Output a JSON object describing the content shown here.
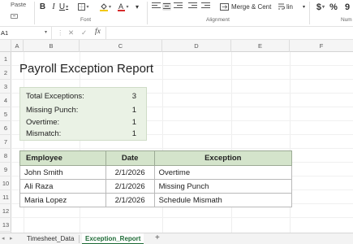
{
  "ribbon": {
    "paste_label": "Paste",
    "font_group_label": "Font",
    "alignment_group_label": "Alignment",
    "number_group_label": "Num",
    "merge_label": "Merge & Cent",
    "wrap_label": "lin",
    "currency_symbol": "$",
    "percent_symbol": "%"
  },
  "formula_bar": {
    "name_box": "A1",
    "cancel_glyph": "✕",
    "confirm_glyph": "✓",
    "fx_label": "fx",
    "formula": ""
  },
  "columns": [
    "A",
    "B",
    "C",
    "D",
    "E",
    "F"
  ],
  "rows": [
    "1",
    "2",
    "3",
    "4",
    "5",
    "6",
    "7",
    "8",
    "9",
    "10",
    "11",
    "12",
    "13"
  ],
  "report": {
    "title": "Payroll Exception Report",
    "summary": [
      {
        "label": "Total Exceptions:",
        "value": "3"
      },
      {
        "label": "Missing Punch:",
        "value": "1"
      },
      {
        "label": "Overtime:",
        "value": "1"
      },
      {
        "label": "Mismatch:",
        "value": "1"
      }
    ],
    "table": {
      "headers": [
        "Employee",
        "Date",
        "Exception"
      ],
      "rows": [
        [
          "John Smith",
          "2/1/2026",
          "Overtime"
        ],
        [
          "Ali Raza",
          "2/1/2026",
          "Missing Punch"
        ],
        [
          "Maria Lopez",
          "2/1/2026",
          "Schedule Mismath"
        ]
      ]
    }
  },
  "sheet_tabs": {
    "tabs": [
      "Timesheet_Data",
      "Exception_Report"
    ],
    "active": "Exception_Report",
    "add_glyph": "+"
  },
  "colors": {
    "accent_green": "#1e6b36",
    "summary_fill": "#eaf2e5",
    "table_header_fill": "#d4e4cb"
  }
}
